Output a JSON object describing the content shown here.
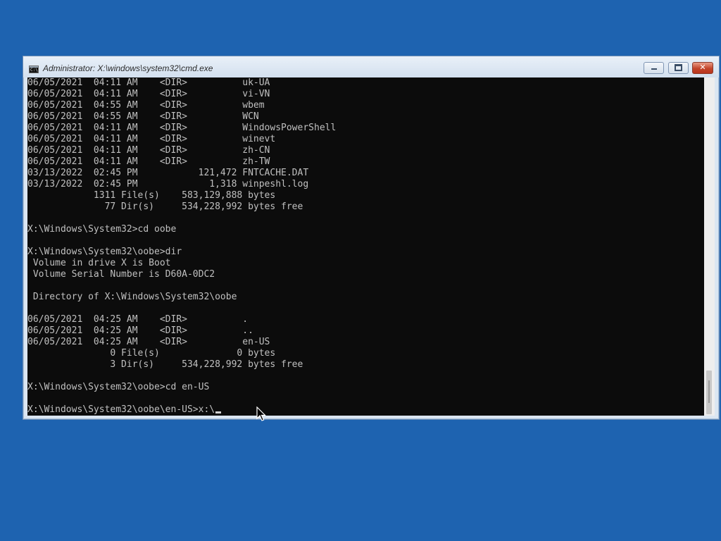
{
  "window": {
    "title": "Administrator: X:\\windows\\system32\\cmd.exe",
    "icon_text": "C:\\.",
    "controls": {
      "minimize": "minimize-icon",
      "maximize": "maximize-icon",
      "close": "✕"
    }
  },
  "console": {
    "lines": [
      "06/05/2021  04:11 AM    <DIR>          uk-UA",
      "06/05/2021  04:11 AM    <DIR>          vi-VN",
      "06/05/2021  04:55 AM    <DIR>          wbem",
      "06/05/2021  04:55 AM    <DIR>          WCN",
      "06/05/2021  04:11 AM    <DIR>          WindowsPowerShell",
      "06/05/2021  04:11 AM    <DIR>          winevt",
      "06/05/2021  04:11 AM    <DIR>          zh-CN",
      "06/05/2021  04:11 AM    <DIR>          zh-TW",
      "03/13/2022  02:45 PM           121,472 FNTCACHE.DAT",
      "03/13/2022  02:45 PM             1,318 winpeshl.log",
      "            1311 File(s)    583,129,888 bytes",
      "              77 Dir(s)     534,228,992 bytes free",
      "",
      "X:\\Windows\\System32>cd oobe",
      "",
      "X:\\Windows\\System32\\oobe>dir",
      " Volume in drive X is Boot",
      " Volume Serial Number is D60A-0DC2",
      "",
      " Directory of X:\\Windows\\System32\\oobe",
      "",
      "06/05/2021  04:25 AM    <DIR>          .",
      "06/05/2021  04:25 AM    <DIR>          ..",
      "06/05/2021  04:25 AM    <DIR>          en-US",
      "               0 File(s)              0 bytes",
      "               3 Dir(s)     534,228,992 bytes free",
      "",
      "X:\\Windows\\System32\\oobe>cd en-US",
      ""
    ],
    "prompt": "X:\\Windows\\System32\\oobe\\en-US>",
    "input": "x:\\"
  },
  "colors": {
    "desktop": "#1e63b0",
    "console_bg": "#0c0c0c",
    "console_fg": "#c0c0c0",
    "close_button": "#c3452b"
  }
}
